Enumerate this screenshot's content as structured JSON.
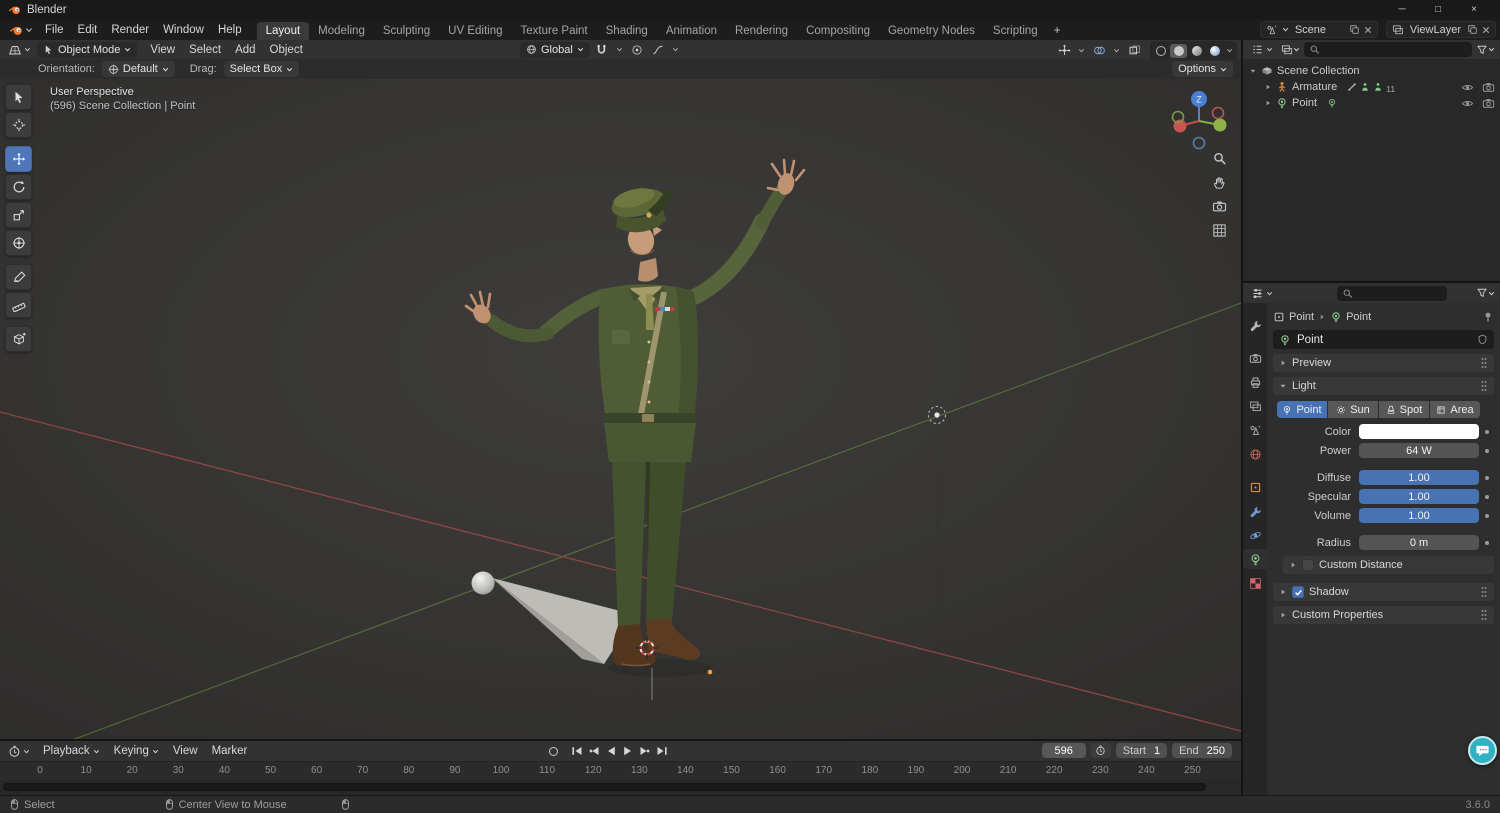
{
  "colors": {
    "accent_blue": "#4772b3",
    "header_bg": "#323232",
    "viewport_bg": "#3a3938",
    "object_orange": "#e08b3a",
    "light_green": "#8fce8f",
    "axis_x_red": "#9d4a44",
    "axis_y_green": "#6b8f3c"
  },
  "window": {
    "title": "Blender",
    "controls": {
      "minimize": "─",
      "maximize": "□",
      "close": "×"
    }
  },
  "topbar": {
    "menus": [
      {
        "label": "File"
      },
      {
        "label": "Edit"
      },
      {
        "label": "Render"
      },
      {
        "label": "Window"
      },
      {
        "label": "Help"
      }
    ],
    "workspaces": [
      {
        "label": "Layout",
        "active": true
      },
      {
        "label": "Modeling"
      },
      {
        "label": "Sculpting"
      },
      {
        "label": "UV Editing"
      },
      {
        "label": "Texture Paint"
      },
      {
        "label": "Shading"
      },
      {
        "label": "Animation"
      },
      {
        "label": "Rendering"
      },
      {
        "label": "Compositing"
      },
      {
        "label": "Geometry Nodes"
      },
      {
        "label": "Scripting"
      }
    ],
    "add_workspace": "+",
    "scene_selector": {
      "value": "Scene"
    },
    "view_layer_selector": {
      "value": "ViewLayer"
    }
  },
  "viewport": {
    "header": {
      "mode": "Object Mode",
      "menus": [
        {
          "label": "View"
        },
        {
          "label": "Select"
        },
        {
          "label": "Add"
        },
        {
          "label": "Object"
        }
      ],
      "orientation": "Global"
    },
    "tool_settings": {
      "orientation_label": "Orientation:",
      "orientation_value": "Default",
      "drag_label": "Drag:",
      "drag_value": "Select Box",
      "options": "Options"
    },
    "overlay": {
      "line1": "User Perspective",
      "line2": "(596) Scene Collection | Point"
    },
    "gizmo_axis_label": "Z"
  },
  "outliner": {
    "rows": [
      {
        "label": "Scene Collection"
      },
      {
        "label": "Armature",
        "badge": "11"
      },
      {
        "label": "Point"
      }
    ]
  },
  "properties": {
    "breadcrumb": {
      "object": "Point",
      "data": "Point"
    },
    "name_field": "Point",
    "panels": {
      "preview": "Preview",
      "light": "Light",
      "custom_distance": "Custom Distance",
      "shadow": "Shadow",
      "custom_properties": "Custom Properties"
    },
    "light_types": [
      {
        "label": "Point",
        "active": true
      },
      {
        "label": "Sun"
      },
      {
        "label": "Spot"
      },
      {
        "label": "Area"
      }
    ],
    "color_label": "Color",
    "color_value": "#ffffff",
    "power_label": "Power",
    "power_value": "64 W",
    "diffuse_label": "Diffuse",
    "diffuse_value": "1.00",
    "specular_label": "Specular",
    "specular_value": "1.00",
    "volume_label": "Volume",
    "volume_value": "1.00",
    "radius_label": "Radius",
    "radius_value": "0 m"
  },
  "timeline": {
    "menus": [
      {
        "label": "Playback",
        "chev": true
      },
      {
        "label": "Keying",
        "chev": true
      },
      {
        "label": "View"
      },
      {
        "label": "Marker"
      }
    ],
    "current_frame": "596",
    "start_label": "Start",
    "start_value": "1",
    "end_label": "End",
    "end_value": "250",
    "ruler": [
      "0",
      "10",
      "20",
      "30",
      "40",
      "50",
      "60",
      "70",
      "80",
      "90",
      "100",
      "110",
      "120",
      "130",
      "140",
      "150",
      "160",
      "170",
      "180",
      "190",
      "200",
      "210",
      "220",
      "230",
      "240",
      "250"
    ]
  },
  "statusbar": {
    "select": "Select",
    "center_view": "Center View to Mouse",
    "version": "3.6.0"
  },
  "icons": {
    "left_toolbar": [
      "select-box",
      "cursor",
      "move",
      "rotate",
      "scale",
      "transform",
      "annotate",
      "measure",
      "add-cube"
    ],
    "viewport_nav": [
      "zoom",
      "pan",
      "camera-view",
      "toggle-orthographic"
    ],
    "properties_tabs": [
      "tool",
      "render",
      "output",
      "view-layer",
      "scene",
      "world",
      "object",
      "modifiers",
      "physics",
      "object-data",
      "texture"
    ],
    "transport": [
      "jump-to-start",
      "previous-keyframe",
      "play-reverse",
      "play",
      "next-keyframe",
      "jump-to-end"
    ]
  }
}
